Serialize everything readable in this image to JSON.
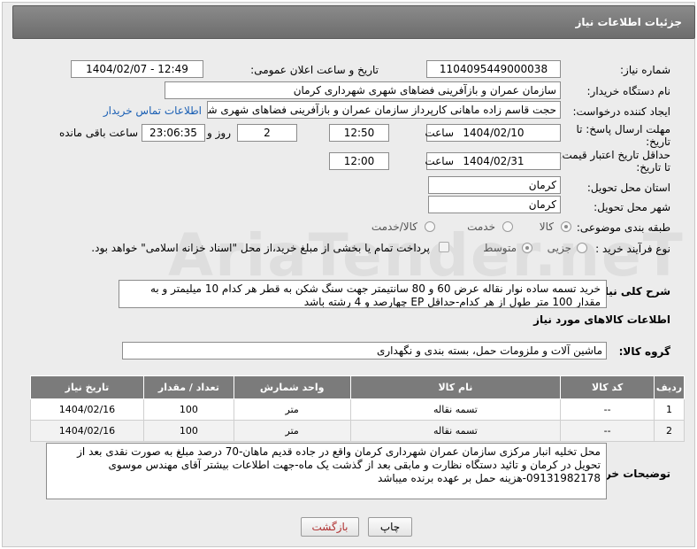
{
  "header": {
    "title": "جزئیات اطلاعات نیاز"
  },
  "fields": {
    "need_number_label": "شماره نیاز:",
    "need_number": "1104095449000038",
    "announce_label": "تاریخ و ساعت اعلان عمومی:",
    "announce_value": "1404/02/07 - 12:49",
    "buyer_org_label": "نام دستگاه خریدار:",
    "buyer_org": "سازمان عمران و بازآفرینی فضاهای شهری شهرداری کرمان",
    "creator_label": "ایجاد کننده درخواست:",
    "creator": "حجت قاسم زاده ماهانی کارپرداز سازمان عمران و بازآفرینی فضاهای شهری شه",
    "contact_link": "اطلاعات تماس خریدار",
    "deadline_label_1": "مهلت ارسال پاسخ: تا",
    "deadline_label_2": "تاریخ:",
    "deadline_date": "1404/02/10",
    "time_label": "ساعت",
    "deadline_time": "12:50",
    "days_value": "2",
    "days_label": "روز و",
    "remaining_time": "23:06:35",
    "remaining_label": "ساعت باقی مانده",
    "validity_label_1": "حداقل تاریخ اعتبار قیمت:",
    "validity_label_2": "تا تاریخ:",
    "validity_date": "1404/02/31",
    "validity_time": "12:00",
    "province_label": "استان محل تحویل:",
    "province": "کرمان",
    "city_label": "شهر محل تحویل:",
    "city": "کرمان",
    "category_label": "طبقه بندی موضوعی:",
    "category_options": [
      "کالا",
      "خدمت",
      "کالا/خدمت"
    ],
    "process_label": "نوع فرآیند خرید :",
    "process_options": [
      "جزیی",
      "متوسط"
    ],
    "payment_note": "پرداخت تمام یا بخشی از مبلغ خرید،از محل \"اسناد خزانه اسلامی\" خواهد بود.",
    "description_label": "شرح کلی نیاز:",
    "description": "خرید تسمه ساده نوار نقاله عرض 60 و 80 سانتیمتر جهت سنگ شکن به قطر هر کدام 10 میلیمتر و به مقدار 100 متر طول از هر کدام-حداقل EP چهارصد و 4 رشته باشد",
    "goods_info_title": "اطلاعات کالاهای مورد نیاز",
    "goods_group_label": "گروه کالا:",
    "goods_group": "ماشین آلات و ملزومات حمل، بسته بندی و نگهداری",
    "buyer_notes_label": "توضیحات خریدار:",
    "buyer_notes": "محل تخلیه انبار مرکزی سازمان عمران شهرداری کرمان واقع در جاده قدیم ماهان-70 درصد مبلغ به صورت نقدی بعد از تحویل در کرمان و تائید دستگاه نظارت و مابقی بعد از گذشت یک ماه-جهت اطلاعات بیشتر آقای مهندس موسوی 09131982178-هزینه حمل بر عهده برنده میباشد"
  },
  "table": {
    "headers": [
      "ردیف",
      "کد کالا",
      "نام کالا",
      "واحد شمارش",
      "تعداد / مقدار",
      "تاریخ نیاز"
    ],
    "rows": [
      [
        "1",
        "--",
        "تسمه نقاله",
        "متر",
        "100",
        "1404/02/16"
      ],
      [
        "2",
        "--",
        "تسمه نقاله",
        "متر",
        "100",
        "1404/02/16"
      ]
    ]
  },
  "buttons": {
    "print": "چاپ",
    "back": "بازگشت"
  },
  "watermark": "AriaTender.neT"
}
